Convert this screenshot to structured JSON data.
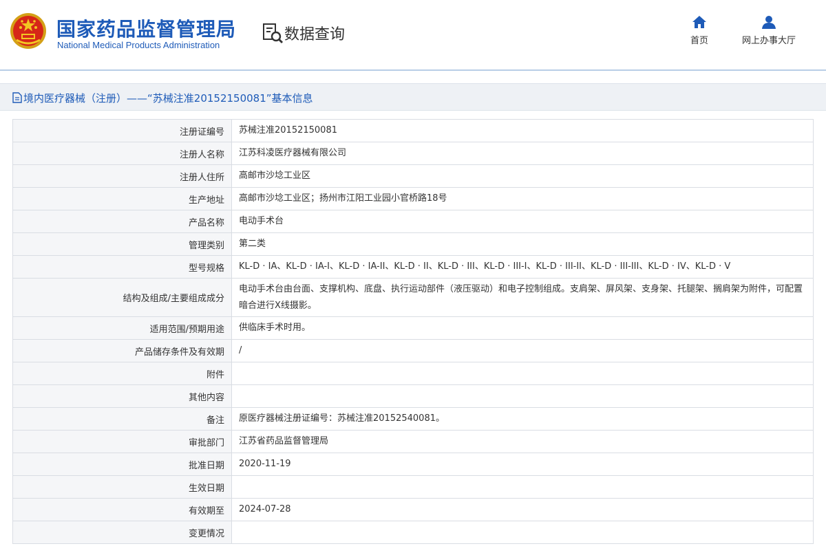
{
  "header": {
    "org_name_cn": "国家药品监督管理局",
    "org_name_en": "National Medical Products Administration",
    "section_title": "数据查询",
    "nav": [
      {
        "label": "首页",
        "icon": "home-icon"
      },
      {
        "label": "网上办事大厅",
        "icon": "user-icon"
      }
    ]
  },
  "breadcrumb": {
    "text": "境内医疗器械（注册）——“苏械注准20152150081”基本信息"
  },
  "colors": {
    "brand_blue": "#1e5bb8",
    "label_bg": "#f5f6f8",
    "border": "#d9dde3"
  },
  "rows": [
    {
      "label": "注册证编号",
      "value": "苏械注准20152150081"
    },
    {
      "label": "注册人名称",
      "value": "江苏科凌医疗器械有限公司"
    },
    {
      "label": "注册人住所",
      "value": "高邮市沙埝工业区"
    },
    {
      "label": "生产地址",
      "value": "高邮市沙埝工业区；扬州市江阳工业园小官桥路18号"
    },
    {
      "label": "产品名称",
      "value": "电动手术台"
    },
    {
      "label": "管理类别",
      "value": "第二类"
    },
    {
      "label": "型号规格",
      "value": "KL-D · IA、KL-D · IA-I、KL-D · IA-II、KL-D · II、KL-D · III、KL-D · III-I、KL-D · III-II、KL-D · III-III、KL-D · IV、KL-D · V"
    },
    {
      "label": "结构及组成/主要组成成分",
      "value": "电动手术台由台面、支撑机构、底盘、执行运动部件（液压驱动）和电子控制组成。支肩架、屏风架、支身架、托腿架、搁肩架为附件，可配置暗合进行X线摄影。"
    },
    {
      "label": "适用范围/预期用途",
      "value": "供临床手术时用。"
    },
    {
      "label": "产品储存条件及有效期",
      "value": "/"
    },
    {
      "label": "附件",
      "value": ""
    },
    {
      "label": "其他内容",
      "value": ""
    },
    {
      "label": "备注",
      "value": "原医疗器械注册证编号：苏械注准20152540081。"
    },
    {
      "label": "审批部门",
      "value": "江苏省药品监督管理局"
    },
    {
      "label": "批准日期",
      "value": "2020-11-19"
    },
    {
      "label": "生效日期",
      "value": ""
    },
    {
      "label": "有效期至",
      "value": "2024-07-28"
    },
    {
      "label": "变更情况",
      "value": ""
    }
  ]
}
